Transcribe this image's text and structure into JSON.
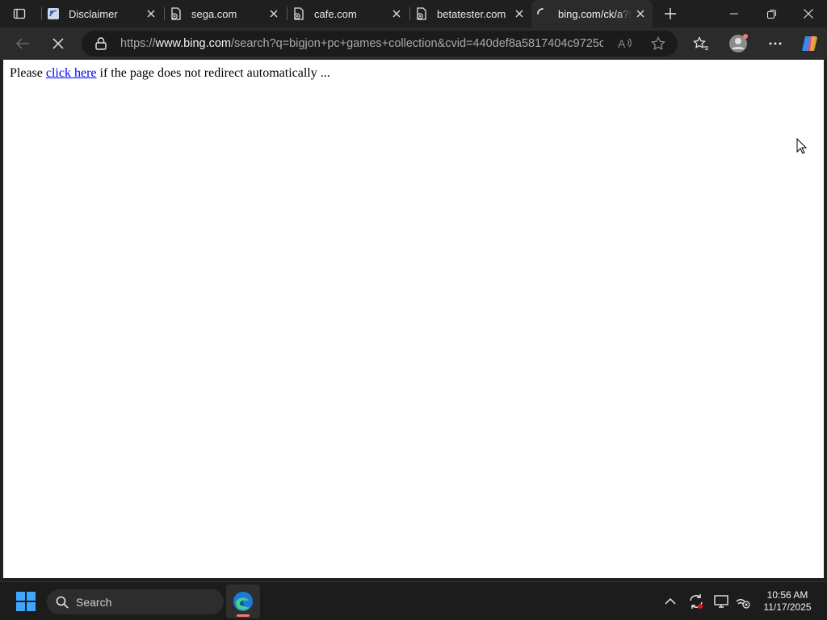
{
  "tabs": [
    {
      "title": "Disclaimer",
      "favicon": "page-favicon-icon",
      "active": false
    },
    {
      "title": "sega.com",
      "favicon": "broken-page-icon",
      "active": false
    },
    {
      "title": "cafe.com",
      "favicon": "broken-page-icon",
      "active": false
    },
    {
      "title": "betatester.com",
      "favicon": "broken-page-icon",
      "active": false
    },
    {
      "title": "bing.com/ck/a?!&",
      "favicon": "loading-spinner-icon",
      "active": true
    }
  ],
  "address_bar": {
    "url_prefix": "https://",
    "url_host": "www.bing.com",
    "url_path": "/search?q=bigjon+pc+games+collection&cvid=440def8a5817404c9725c..."
  },
  "page": {
    "text_before": "Please ",
    "link_text": "click here",
    "text_after": " if the page does not redirect automatically ..."
  },
  "taskbar": {
    "search_label": "Search",
    "time": "10:56 AM",
    "date": "11/17/2025"
  },
  "colors": {
    "link": "#0000ee",
    "edge_accent": "#f47a6b"
  }
}
